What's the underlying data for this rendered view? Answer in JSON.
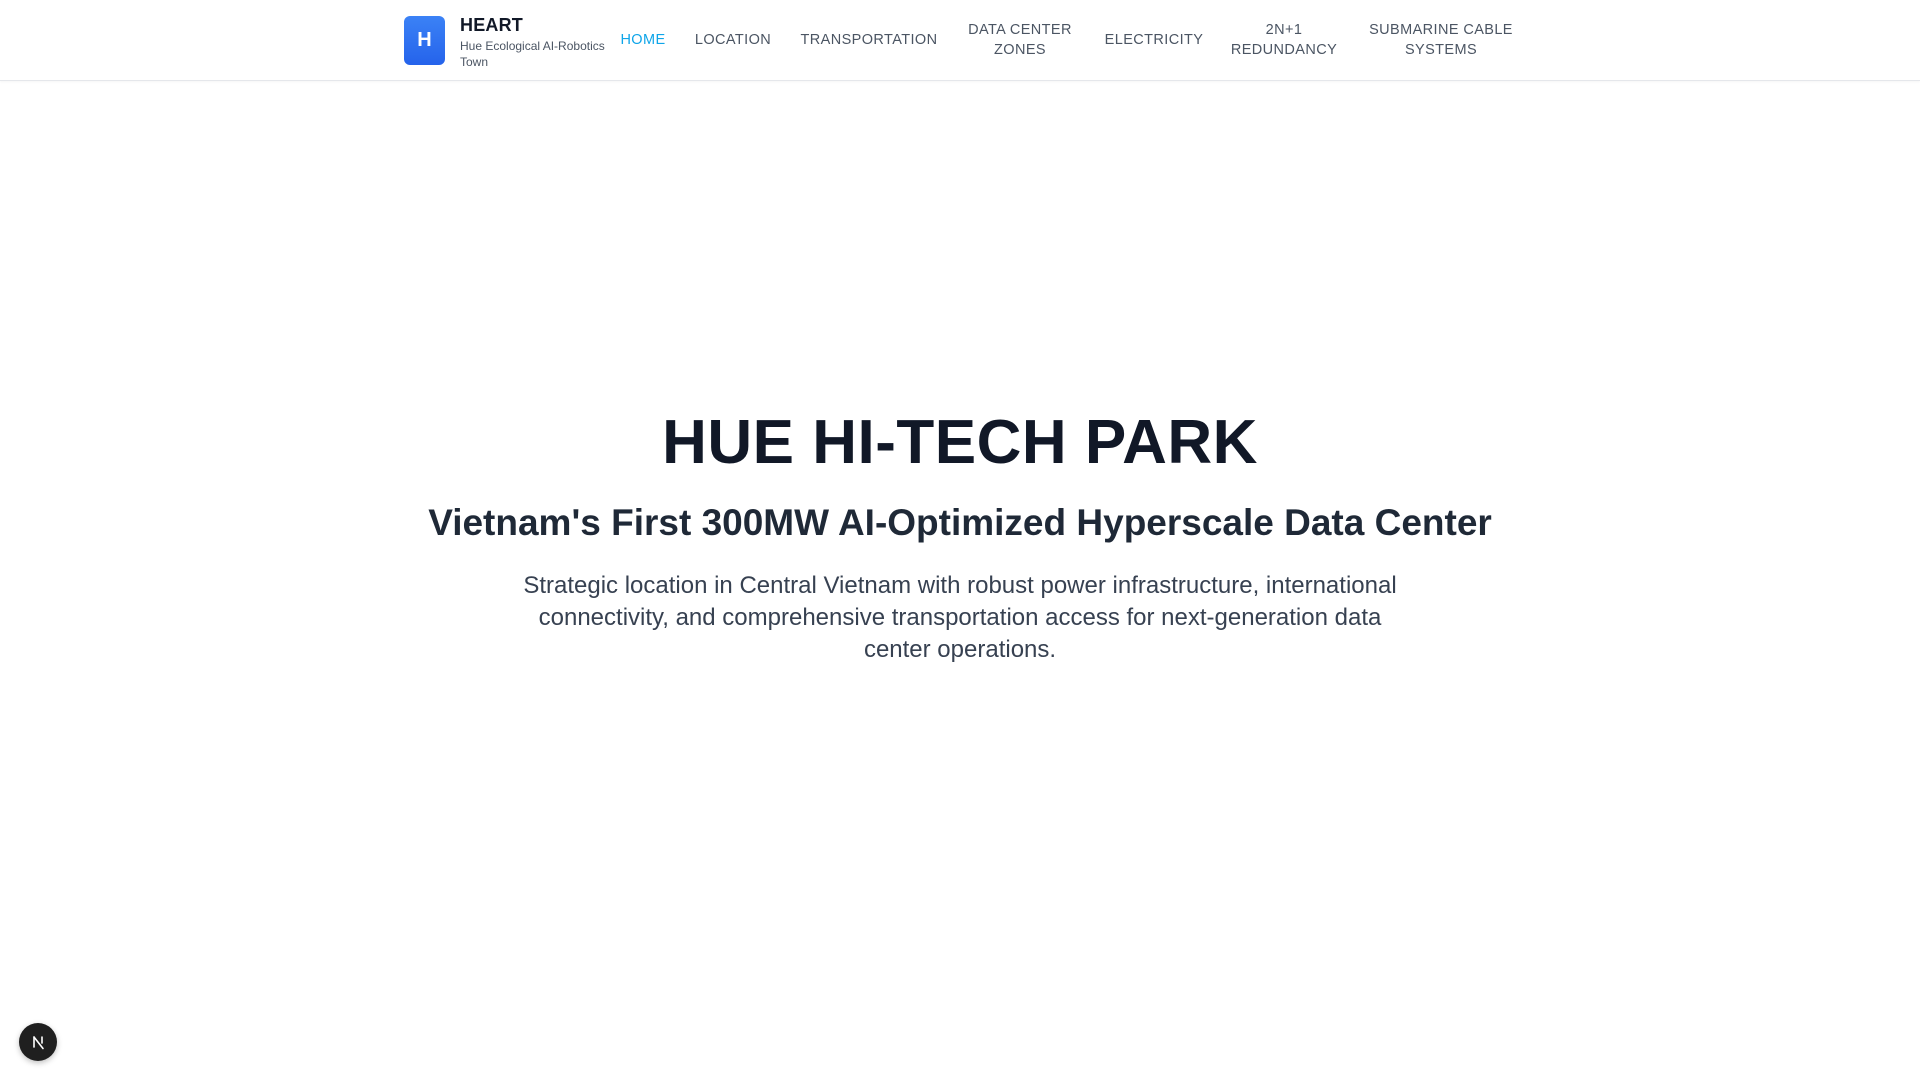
{
  "header": {
    "logo_letter": "H",
    "brand_name": "HEART",
    "brand_subtitle": "Hue Ecological AI-Robotics Town",
    "nav": [
      {
        "label": "HOME",
        "active": true
      },
      {
        "label": "LOCATION",
        "active": false
      },
      {
        "label": "TRANSPORTATION",
        "active": false
      },
      {
        "label": "DATA CENTER ZONES",
        "active": false
      },
      {
        "label": "ELECTRICITY",
        "active": false
      },
      {
        "label": "2N+1 REDUNDANCY",
        "active": false
      },
      {
        "label": "SUBMARINE CABLE SYSTEMS",
        "active": false
      }
    ]
  },
  "hero": {
    "title": "HUE HI-TECH PARK",
    "subtitle": "Vietnam's First 300MW AI-Optimized Hyperscale Data Center",
    "description": "Strategic location in Central Vietnam with robust power infrastructure, international connectivity, and comprehensive transportation access for next-generation data center operations."
  },
  "dev_indicator": {
    "icon": "nextjs-logo-icon",
    "letter": "N"
  },
  "colors": {
    "accent": "#0ea5e9",
    "logo_blue": "#2563eb",
    "nav_text": "#4b5563",
    "heading": "#111827"
  }
}
